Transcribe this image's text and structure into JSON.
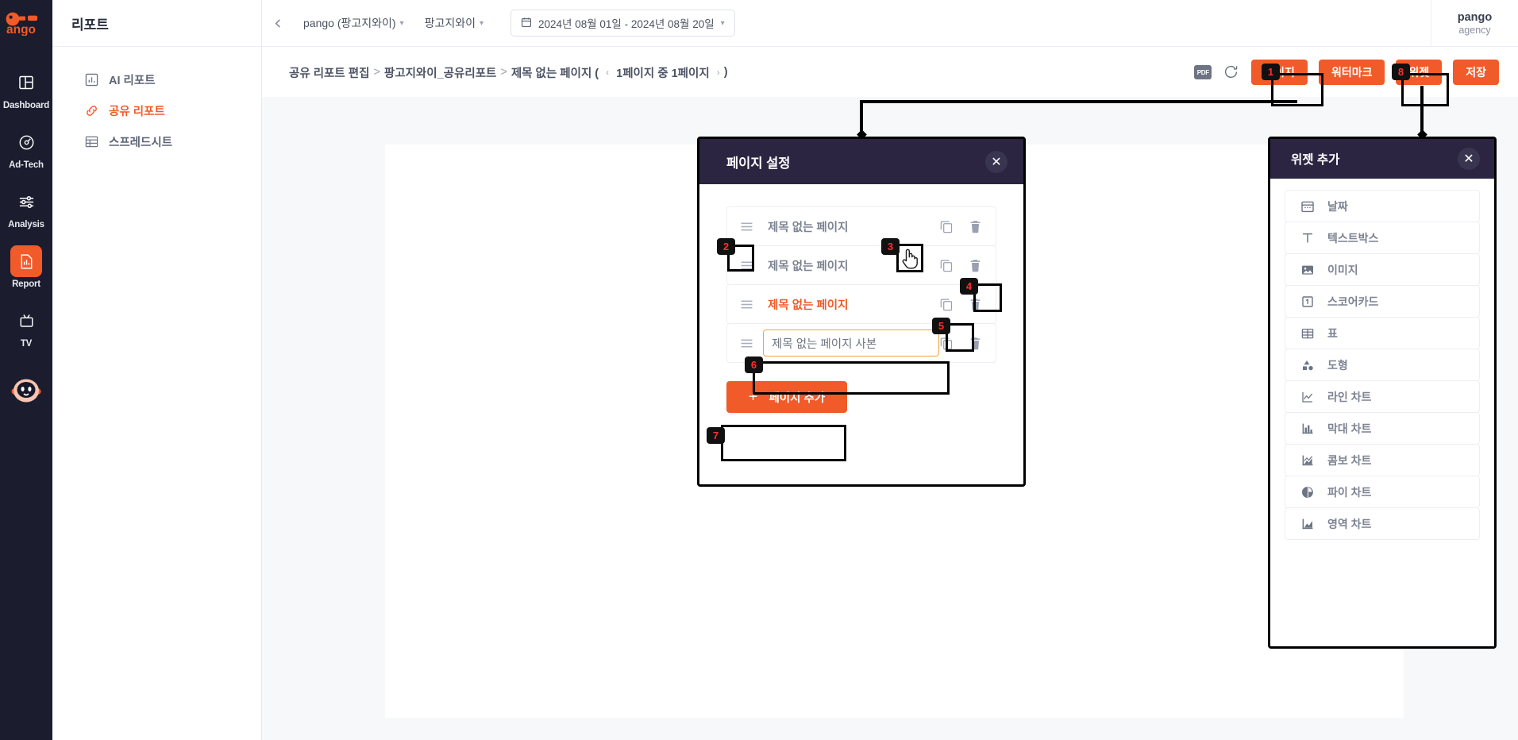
{
  "rail": {
    "logo_text": "pango",
    "items": [
      {
        "label": "Dashboard",
        "icon": "dashboard-icon",
        "active": false
      },
      {
        "label": "Ad-Tech",
        "icon": "gauge-icon",
        "active": false
      },
      {
        "label": "Analysis",
        "icon": "sliders-icon",
        "active": false
      },
      {
        "label": "Report",
        "icon": "report-icon",
        "active": true
      },
      {
        "label": "TV",
        "icon": "tv-icon",
        "active": false
      }
    ],
    "mascot": "pango-mascot-icon"
  },
  "subnav": {
    "title": "리포트",
    "items": [
      {
        "label": "AI 리포트",
        "icon": "bar-chart-icon",
        "active": false
      },
      {
        "label": "공유 리포트",
        "icon": "link-icon",
        "active": true
      },
      {
        "label": "스프레드시트",
        "icon": "table-icon",
        "active": false
      }
    ]
  },
  "topbar": {
    "collapse_icon": "chevron-left-icon",
    "account_select": "pango (팡고지와이)",
    "media_select": "팡고지와이",
    "date_range": "2024년 08월 01일 - 2024년 08월 20일",
    "calendar_icon": "calendar-icon",
    "caret_icon": "chevron-down-icon",
    "user": {
      "name": "pango",
      "role": "agency"
    }
  },
  "actionbar": {
    "breadcrumb": {
      "part1": "공유 리포트 편집",
      "sep": ">",
      "part2": "팡고지와이_공유리포트",
      "part3": "제목 없는 페이지 (",
      "pager_prev": "‹",
      "pager_text": "1페이지 중 1페이지",
      "pager_next": "›",
      "part4": ")"
    },
    "pdf_label": "PDF",
    "refresh_icon": "refresh-icon",
    "buttons": [
      {
        "label": "페이지",
        "name": "page-button"
      },
      {
        "label": "워터마크",
        "name": "watermark-button"
      },
      {
        "label": "위젯",
        "name": "widget-button"
      },
      {
        "label": "저장",
        "name": "save-button"
      }
    ]
  },
  "page_modal": {
    "title": "페이지 설정",
    "close_icon": "close-icon",
    "rows": [
      {
        "name": "제목 없는 페이지",
        "selected": false,
        "editing": false
      },
      {
        "name": "제목 없는 페이지",
        "selected": false,
        "editing": false
      },
      {
        "name": "제목 없는 페이지",
        "selected": true,
        "editing": false
      },
      {
        "name": "제목 없는 페이지 사본",
        "selected": false,
        "editing": true
      }
    ],
    "drag_icon": "drag-handle-icon",
    "copy_icon": "copy-icon",
    "delete_icon": "trash-icon",
    "add_button": {
      "label": "페이지 추가",
      "plus": "+"
    }
  },
  "widget_modal": {
    "title": "위젯 추가",
    "close_icon": "close-icon",
    "items": [
      {
        "label": "날짜",
        "icon": "calendar-icon"
      },
      {
        "label": "텍스트박스",
        "icon": "text-icon"
      },
      {
        "label": "이미지",
        "icon": "image-icon"
      },
      {
        "label": "스코어카드",
        "icon": "scorecard-icon"
      },
      {
        "label": "표",
        "icon": "table-icon"
      },
      {
        "label": "도형",
        "icon": "shapes-icon"
      },
      {
        "label": "라인 차트",
        "icon": "line-chart-icon"
      },
      {
        "label": "막대 차트",
        "icon": "bar-chart-icon"
      },
      {
        "label": "콤보 차트",
        "icon": "combo-chart-icon"
      },
      {
        "label": "파이 차트",
        "icon": "pie-chart-icon"
      },
      {
        "label": "영역 차트",
        "icon": "area-chart-icon"
      }
    ]
  },
  "step_badges": [
    {
      "n": "1",
      "target": "page-button"
    },
    {
      "n": "2",
      "target": "drag-handle-row-1"
    },
    {
      "n": "3",
      "target": "cursor-row-1"
    },
    {
      "n": "4",
      "target": "delete-row-2"
    },
    {
      "n": "5",
      "target": "copy-row-3"
    },
    {
      "n": "6",
      "target": "page-name-input-row-4"
    },
    {
      "n": "7",
      "target": "add-page-button"
    },
    {
      "n": "8",
      "target": "widget-button"
    }
  ],
  "colors": {
    "brand_orange": "#f15a29",
    "rail_dark": "#1b1d2e",
    "modal_header": "#2b2542",
    "input_focus": "#f0a33a",
    "badge_bg": "#111111",
    "badge_fg": "#ff2f2f"
  }
}
